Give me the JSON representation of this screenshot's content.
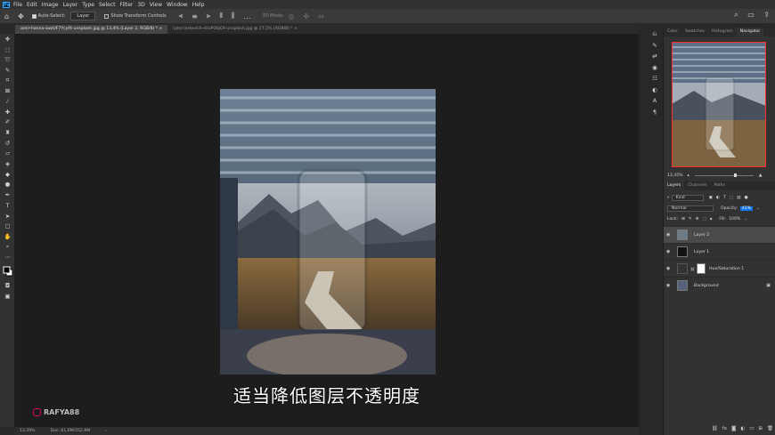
{
  "menu": {
    "items": [
      "File",
      "Edit",
      "Image",
      "Layer",
      "Type",
      "Select",
      "Filter",
      "3D",
      "View",
      "Window",
      "Help"
    ]
  },
  "options": {
    "auto_select_label": "Auto-Select:",
    "auto_select_value": "Layer",
    "show_transform_label": "Show Transform Controls",
    "mode_3d_label": "3D Mode:"
  },
  "tabs": [
    {
      "label": "amir-hanna-swzUF7Ycyf4-unsplash.jpg @ 13,4% (Layer 2, RGB/8) *  ×"
    },
    {
      "label": "tyler-lastovich-ehzPObjOt-unsplash.jpg @ 27,5% (RGB/8) *  ×"
    }
  ],
  "subtitle": "适当降低图层不透明度",
  "watermark": "RAFYA88",
  "status": {
    "zoom": "13,39%",
    "doc": "Doc: 61,6M/352,6M"
  },
  "panel_tabs_top": [
    "Color",
    "Swatches",
    "Histogram",
    "Navigator"
  ],
  "navigator": {
    "zoom": "13,35%"
  },
  "panel_tabs_layers": [
    "Layers",
    "Channels",
    "Paths"
  ],
  "layers_panel": {
    "kind_label": "Kind",
    "blend_mode": "Normal",
    "opacity_label": "Opacity:",
    "opacity_value": "41%",
    "lock_label": "Lock:",
    "fill_label": "Fill:",
    "fill_value": "100%",
    "layers": [
      {
        "name": "Layer 2"
      },
      {
        "name": "Layer 1"
      },
      {
        "name": "Hue/Saturation 1"
      },
      {
        "name": "Background"
      }
    ]
  },
  "colors": {
    "accent_red": "#ff2e2e",
    "selection_blue": "#1473e6",
    "ps_blue": "#31a8ff"
  }
}
